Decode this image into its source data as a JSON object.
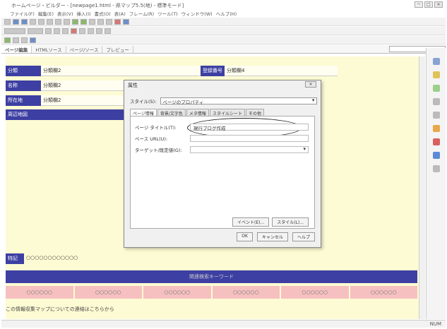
{
  "window": {
    "title": "ホームページ・ビルダー - [newpage1.html - 県マップ5.5(地) - 標準モード]",
    "min": "－",
    "max": "□",
    "close": "×"
  },
  "menu": [
    "ファイル(F)",
    "編集(E)",
    "表示(V)",
    "挿入(I)",
    "書式(O)",
    "表(A)",
    "フレーム(R)",
    "ツール(T)",
    "ウィンドウ(W)",
    "ヘルプ(H)"
  ],
  "tabs": [
    "ページ編集",
    "HTMLソース",
    "ページ/ソース",
    "プレビュー"
  ],
  "document": {
    "row1": {
      "label": "分類",
      "value": "分類欄2",
      "label2": "登録番号",
      "value2": "分類欄4"
    },
    "row2": {
      "label": "名称",
      "value": "分類欄2"
    },
    "row3": {
      "label": "所在地",
      "value": "分類欄2"
    },
    "row4": {
      "label": "周辺地図"
    },
    "row5": {
      "label": "特記",
      "value": "○○○○○○○○○○○○"
    },
    "keywords_bar": "関連検索キーワード",
    "cells": [
      "○○○○○○",
      "○○○○○○",
      "○○○○○○",
      "○○○○○○",
      "○○○○○○",
      "○○○○○○"
    ],
    "footer": "この情報収集マップについての連絡はこちらから"
  },
  "dialog": {
    "title": "属性",
    "close": "×",
    "style_label": "スタイル(S):",
    "style_value": "ページのプロパティ",
    "tabs": [
      "ページ情報",
      "背景/文字色",
      "メタ情報",
      "スタイルシート",
      "その他"
    ],
    "page_title_label": "ページ タイトル(T):",
    "page_title_value": "現行ブログ作成",
    "base_url_label": "ベース URL(U):",
    "base_url_value": "",
    "target_frame_label": "ターゲット/既定値(G):",
    "target_frame_value": "",
    "btn_event": "イベント(E)...",
    "btn_style": "スタイル(L)...",
    "btn_ok": "OK",
    "btn_cancel": "キャンセル",
    "btn_help": "ヘルプ"
  },
  "status": {
    "right": "NUM"
  }
}
